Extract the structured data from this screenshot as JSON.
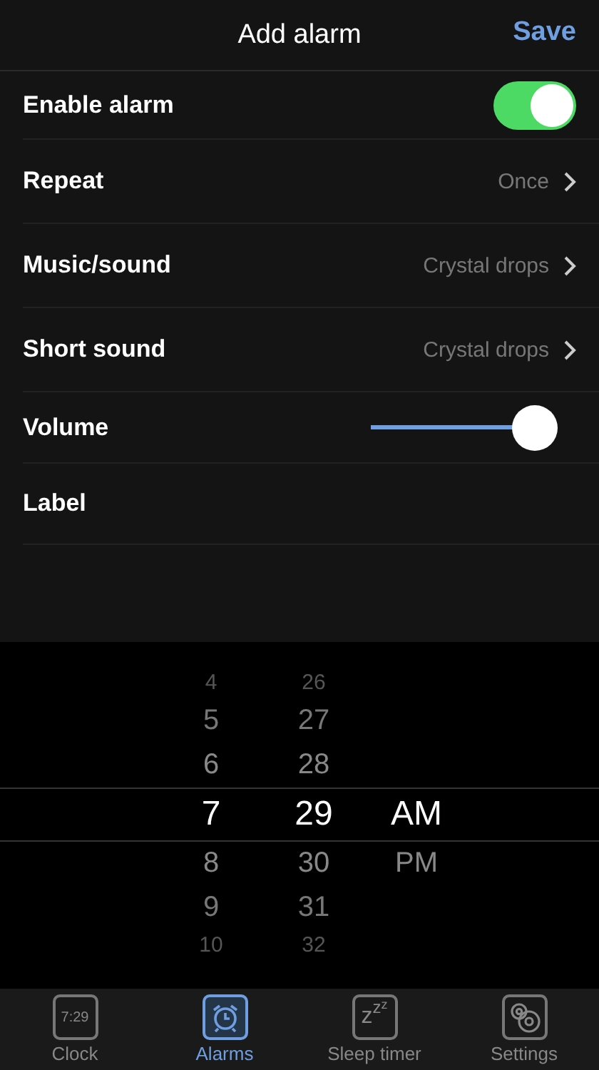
{
  "header": {
    "title": "Add alarm",
    "action": "Save"
  },
  "rows": [
    {
      "kind": "toggle",
      "label": "Enable alarm",
      "on": true
    },
    {
      "kind": "value",
      "label": "Repeat",
      "value": "Once"
    },
    {
      "kind": "value",
      "label": "Music/sound",
      "value": "Crystal drops"
    },
    {
      "kind": "value",
      "label": "Short sound",
      "value": "Crystal drops"
    },
    {
      "kind": "slider",
      "label": "Volume",
      "level": 0.88
    },
    {
      "kind": "plain",
      "label": "Label"
    }
  ],
  "picker": {
    "columns": [
      {
        "items": [
          {
            "label": "4",
            "selected": false
          },
          {
            "label": "5",
            "selected": false
          },
          {
            "label": "6",
            "selected": false
          },
          {
            "label": "7",
            "selected": true
          },
          {
            "label": "8",
            "selected": false
          },
          {
            "label": "9",
            "selected": false
          },
          {
            "label": "10",
            "selected": false
          }
        ]
      },
      {
        "items": [
          {
            "label": "26",
            "selected": false
          },
          {
            "label": "27",
            "selected": false
          },
          {
            "label": "28",
            "selected": false
          },
          {
            "label": "29",
            "selected": true
          },
          {
            "label": "30",
            "selected": false
          },
          {
            "label": "31",
            "selected": false
          },
          {
            "label": "32",
            "selected": false
          }
        ]
      },
      {
        "items": [
          {
            "label": "AM",
            "selected": true
          },
          {
            "label": "PM",
            "selected": false
          }
        ]
      }
    ]
  },
  "tabs": [
    {
      "kind": "clock",
      "label": "Clock",
      "icon_text": "7:29",
      "selected": false
    },
    {
      "kind": "alarm",
      "label": "Alarms",
      "selected": true
    },
    {
      "kind": "sleep",
      "label": "Sleep timer",
      "icon_text": "zzz",
      "selected": false
    },
    {
      "kind": "settings",
      "label": "Settings",
      "selected": false
    }
  ]
}
